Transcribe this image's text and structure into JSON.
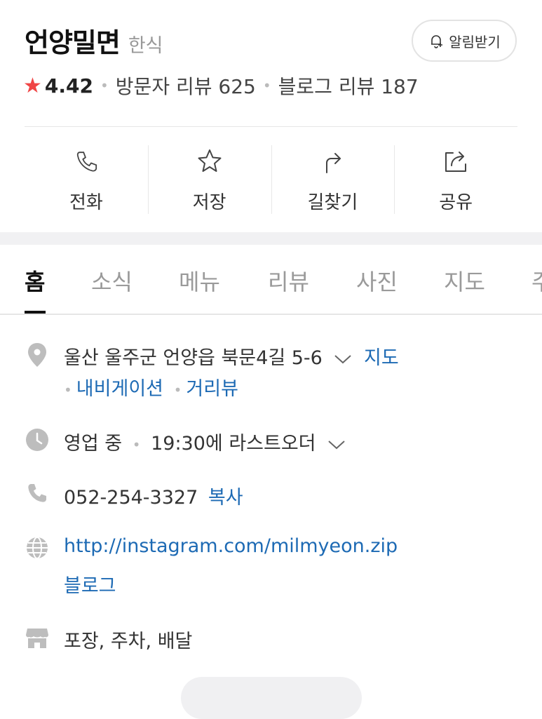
{
  "place": {
    "name": "언양밀면",
    "category": "한식",
    "notify_label": "알림받기"
  },
  "rating": {
    "score": "4.42",
    "visitor_reviews": "방문자 리뷰 625",
    "blog_reviews": "블로그 리뷰 187",
    "star_color": "#f04545"
  },
  "actions": [
    {
      "label": "전화",
      "icon": "phone-icon"
    },
    {
      "label": "저장",
      "icon": "star-icon"
    },
    {
      "label": "길찾기",
      "icon": "directions-icon"
    },
    {
      "label": "공유",
      "icon": "share-icon"
    }
  ],
  "tabs": [
    "홈",
    "소식",
    "메뉴",
    "리뷰",
    "사진",
    "지도",
    "주"
  ],
  "active_tab": "홈",
  "info": {
    "address": "울산 울주군 언양읍 북문4길 5-6",
    "map_link": "지도",
    "navigation_link": "내비게이션",
    "street_view_link": "거리뷰",
    "status": "영업 중",
    "last_order": "19:30에 라스트오더",
    "phone": "052-254-3327",
    "copy_label": "복사",
    "website": "http://instagram.com/milmyeon.zip",
    "blog_label": "블로그",
    "services": "포장, 주차, 배달"
  },
  "colors": {
    "link": "#1d6ab4",
    "icon_gray": "#bdbdbd"
  }
}
